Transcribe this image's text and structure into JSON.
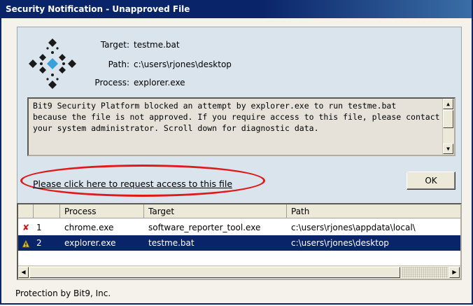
{
  "window": {
    "title": "Security Notification - Unapproved File"
  },
  "info": {
    "target_label": "Target:",
    "target_value": "testme.bat",
    "path_label": "Path:",
    "path_value": "c:\\users\\rjones\\desktop",
    "process_label": "Process:",
    "process_value": "explorer.exe"
  },
  "message": {
    "line1": "Bit9 Security Platform blocked an attempt by explorer.exe to run testme.bat",
    "line2": "because the file is not approved.  If you require access to this file, please contact",
    "line3": "your system administrator.  Scroll down for diagnostic data."
  },
  "request_link": "Please click here to request access to this file",
  "ok_label": "OK",
  "table": {
    "headers": [
      "",
      "",
      "Process",
      "Target",
      "Path"
    ],
    "rows": [
      {
        "icon": "red-x-icon",
        "index": "1",
        "process": "chrome.exe",
        "target": "software_reporter_tool.exe",
        "path": "c:\\users\\rjones\\appdata\\local\\"
      },
      {
        "icon": "warning-icon",
        "index": "2",
        "process": "explorer.exe",
        "target": "testme.bat",
        "path": "c:\\users\\rjones\\desktop"
      }
    ]
  },
  "footer": "Protection by Bit9, Inc.",
  "colors": {
    "titlebar": "#0a246a",
    "selection": "#0a246a",
    "highlight_ellipse": "#e01a1a",
    "logo_accent": "#3aa0d8"
  }
}
